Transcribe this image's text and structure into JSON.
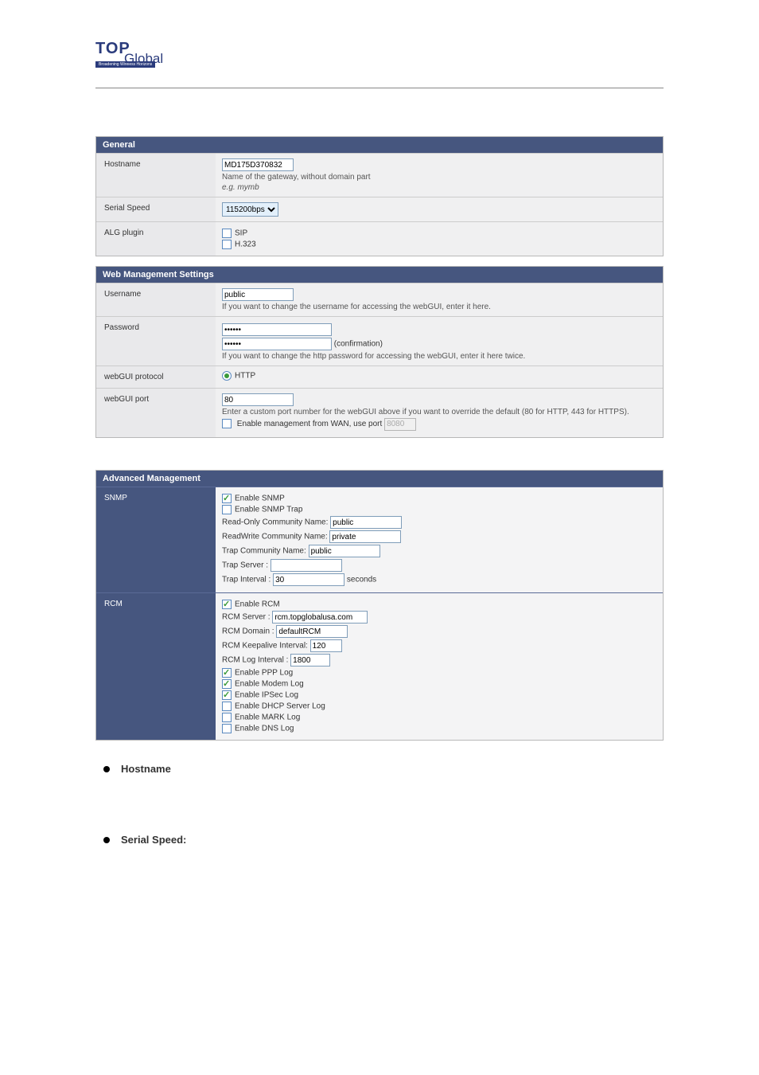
{
  "logo": {
    "top": "TOP",
    "global": "Global",
    "tagline": "Broadening Wireless Horizons"
  },
  "sectionTitle": "",
  "figureLabel": "",
  "general": {
    "header": "General",
    "hostname": {
      "label": "Hostname",
      "value": "MD175D370832",
      "hint1": "Name of the gateway, without domain part",
      "hint2": "e.g. mymb"
    },
    "serial": {
      "label": "Serial Speed",
      "value": "115200bps"
    },
    "alg": {
      "label": "ALG plugin",
      "sip": "SIP",
      "h323": "H.323"
    }
  },
  "web": {
    "header": "Web Management Settings",
    "username": {
      "label": "Username",
      "value": "public",
      "hint": "If you want to change the username for accessing the webGUI, enter it here."
    },
    "password": {
      "label": "Password",
      "value": "******",
      "confirm": "******",
      "confirmLabel": "(confirmation)",
      "hint": "If you want to change the http password for accessing the webGUI, enter it here twice."
    },
    "protocol": {
      "label": "webGUI protocol",
      "http": "HTTP"
    },
    "port": {
      "label": "webGUI port",
      "value": "80",
      "hint": "Enter a custom port number for the webGUI above if you want to override the default (80 for HTTP, 443 for HTTPS).",
      "wanLabel": "Enable management from WAN, use port",
      "wanPort": "8080"
    }
  },
  "advanced": {
    "header": "Advanced Management",
    "snmp": {
      "label": "SNMP",
      "enable": "Enable SNMP",
      "enableTrap": "Enable SNMP Trap",
      "roCommLabel": "Read-Only Community Name:",
      "roCommValue": "public",
      "rwCommLabel": "ReadWrite Community Name:",
      "rwCommValue": "private",
      "trapCommLabel": "Trap Community Name:",
      "trapCommValue": "public",
      "trapServerLabel": "Trap Server :",
      "trapServerValue": "",
      "trapIntervalLabel": "Trap Interval :",
      "trapIntervalValue": "30",
      "seconds": "seconds"
    },
    "rcm": {
      "label": "RCM",
      "enable": "Enable RCM",
      "serverLabel": "RCM Server :",
      "serverValue": "rcm.topglobalusa.com",
      "domainLabel": "RCM Domain :",
      "domainValue": "defaultRCM",
      "keepaliveLabel": "RCM Keepalive Interval:",
      "keepaliveValue": "120",
      "logIntervalLabel": "RCM Log Interval :",
      "logIntervalValue": "1800",
      "pppLog": "Enable PPP Log",
      "modemLog": "Enable Modem Log",
      "ipsecLog": "Enable IPSec Log",
      "dhcpLog": "Enable DHCP Server Log",
      "markLog": "Enable MARK Log",
      "dnsLog": "Enable DNS Log"
    }
  },
  "bodyText": {
    "hostnameTitle": "Hostname",
    "hostnameBody1": "",
    "hostnameBody2": "",
    "serialTitle": "Serial Speed",
    "serialColon": ":",
    "serialBody": ""
  }
}
